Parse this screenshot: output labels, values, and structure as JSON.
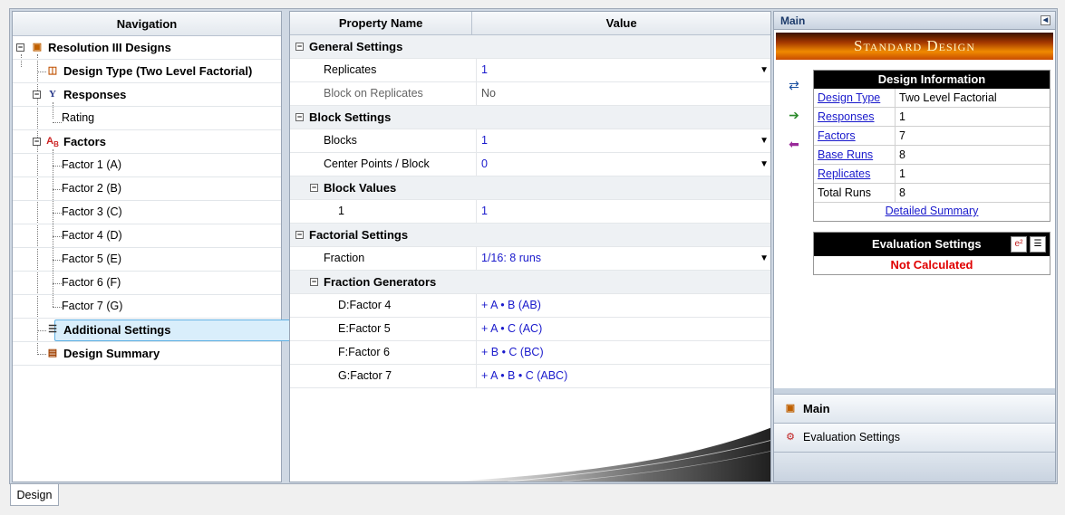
{
  "navigation": {
    "header": "Navigation",
    "root": "Resolution III Designs",
    "design_type": "Design Type (Two Level Factorial)",
    "responses": "Responses",
    "rating": "Rating",
    "factors": "Factors",
    "factor_items": [
      "Factor 1 (A)",
      "Factor 2 (B)",
      "Factor 3 (C)",
      "Factor 4 (D)",
      "Factor 5 (E)",
      "Factor 6 (F)",
      "Factor 7 (G)"
    ],
    "additional_settings": "Additional Settings",
    "design_summary": "Design Summary"
  },
  "grid": {
    "col_property": "Property Name",
    "col_value": "Value",
    "general_settings": "General Settings",
    "replicates_label": "Replicates",
    "replicates_value": "1",
    "block_on_replicates_label": "Block on Replicates",
    "block_on_replicates_value": "No",
    "block_settings": "Block Settings",
    "blocks_label": "Blocks",
    "blocks_value": "1",
    "center_points_label": "Center Points / Block",
    "center_points_value": "0",
    "block_values": "Block Values",
    "block_values_row_label": "1",
    "block_values_row_value": "1",
    "factorial_settings": "Factorial Settings",
    "fraction_label": "Fraction",
    "fraction_value": "1/16: 8 runs",
    "fraction_generators": "Fraction Generators",
    "generators": [
      {
        "label": "D:Factor 4",
        "value": "+ A • B (AB)"
      },
      {
        "label": "E:Factor 5",
        "value": "+ A • C (AC)"
      },
      {
        "label": "F:Factor 6",
        "value": "+ B • C (BC)"
      },
      {
        "label": "G:Factor 7",
        "value": "+ A • B • C (ABC)"
      }
    ]
  },
  "right_panel": {
    "title": "Main",
    "banner": "Standard Design",
    "design_info": {
      "title": "Design Information",
      "rows": [
        {
          "key": "Design Type",
          "value": "Two Level Factorial"
        },
        {
          "key": "Responses",
          "value": "1"
        },
        {
          "key": "Factors",
          "value": "7"
        },
        {
          "key": "Base Runs",
          "value": "8"
        },
        {
          "key": "Replicates",
          "value": "1"
        },
        {
          "key": "Total Runs",
          "value": "8"
        }
      ],
      "detailed_summary": "Detailed Summary"
    },
    "evaluation": {
      "title": "Evaluation Settings",
      "status": "Not Calculated"
    },
    "accordion_main": "Main",
    "accordion_eval": "Evaluation Settings"
  },
  "tabs": {
    "design": "Design"
  },
  "colors": {
    "link": "#1a1acc",
    "selection": "#d9eefb",
    "status_red": "#e00000"
  }
}
